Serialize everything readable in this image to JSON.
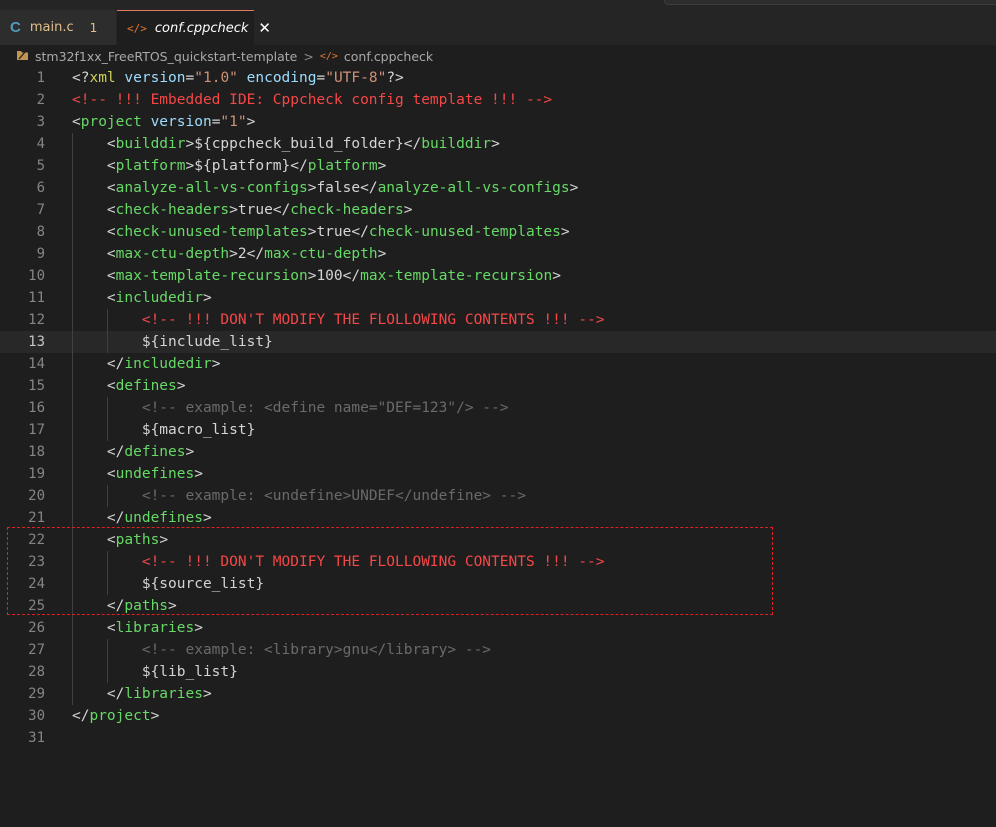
{
  "tabs": [
    {
      "icon": "c-file-icon",
      "icon_glyph": "C",
      "label": "main.c",
      "badge": "1",
      "active": false
    },
    {
      "icon": "xml-file-icon",
      "icon_glyph": "</>",
      "label": "conf.cppcheck",
      "active": true,
      "close_glyph": "✕"
    }
  ],
  "breadcrumb": {
    "folder": "stm32f1xx_FreeRTOS_quickstart-template",
    "separator": ">",
    "file": "conf.cppcheck",
    "file_icon_glyph": "</>"
  },
  "editor": {
    "current_line": 13,
    "lines": [
      {
        "n": "1",
        "html": "<span class='br'>&lt;?</span><span class='pi'>xml</span> <span class='attr'>version</span><span class='br'>=</span><span class='str'>\"1.0\"</span> <span class='attr'>encoding</span><span class='br'>=</span><span class='str'>\"UTF-8\"</span><span class='br'>?&gt;</span>"
      },
      {
        "n": "2",
        "html": "<span class='red'>&lt;!-- !!! Embedded IDE: Cppcheck config template !!! --&gt;</span>"
      },
      {
        "n": "3",
        "html": "<span class='br'>&lt;</span><span class='tag'>project</span> <span class='attr'>version</span><span class='br'>=</span><span class='str'>\"1\"</span><span class='br'>&gt;</span>"
      },
      {
        "n": "4",
        "indent": 1,
        "html": "    <span class='br'>&lt;</span><span class='tag'>builddir</span><span class='br'>&gt;</span><span class='txt'>${cppcheck_build_folder}</span><span class='br'>&lt;/</span><span class='tag'>builddir</span><span class='br'>&gt;</span>"
      },
      {
        "n": "5",
        "indent": 1,
        "html": "    <span class='br'>&lt;</span><span class='tag'>platform</span><span class='br'>&gt;</span><span class='txt'>${platform}</span><span class='br'>&lt;/</span><span class='tag'>platform</span><span class='br'>&gt;</span>"
      },
      {
        "n": "6",
        "indent": 1,
        "html": "    <span class='br'>&lt;</span><span class='tag'>analyze-all-vs-configs</span><span class='br'>&gt;</span><span class='txt'>false</span><span class='br'>&lt;/</span><span class='tag'>analyze-all-vs-configs</span><span class='br'>&gt;</span>"
      },
      {
        "n": "7",
        "indent": 1,
        "html": "    <span class='br'>&lt;</span><span class='tag'>check-headers</span><span class='br'>&gt;</span><span class='txt'>true</span><span class='br'>&lt;/</span><span class='tag'>check-headers</span><span class='br'>&gt;</span>"
      },
      {
        "n": "8",
        "indent": 1,
        "html": "    <span class='br'>&lt;</span><span class='tag'>check-unused-templates</span><span class='br'>&gt;</span><span class='txt'>true</span><span class='br'>&lt;/</span><span class='tag'>check-unused-templates</span><span class='br'>&gt;</span>"
      },
      {
        "n": "9",
        "indent": 1,
        "html": "    <span class='br'>&lt;</span><span class='tag'>max-ctu-depth</span><span class='br'>&gt;</span><span class='txt'>2</span><span class='br'>&lt;/</span><span class='tag'>max-ctu-depth</span><span class='br'>&gt;</span>"
      },
      {
        "n": "10",
        "indent": 1,
        "html": "    <span class='br'>&lt;</span><span class='tag'>max-template-recursion</span><span class='br'>&gt;</span><span class='txt'>100</span><span class='br'>&lt;/</span><span class='tag'>max-template-recursion</span><span class='br'>&gt;</span>"
      },
      {
        "n": "11",
        "indent": 1,
        "html": "    <span class='br'>&lt;</span><span class='tag'>includedir</span><span class='br'>&gt;</span>"
      },
      {
        "n": "12",
        "indent": 2,
        "html": "        <span class='red'>&lt;!-- !!! DON'T MODIFY THE FLOLLOWING CONTENTS !!! --&gt;</span>"
      },
      {
        "n": "13",
        "indent": 2,
        "html": "        <span class='txt'>${include_list}</span>"
      },
      {
        "n": "14",
        "indent": 1,
        "html": "    <span class='br'>&lt;/</span><span class='tag'>includedir</span><span class='br'>&gt;</span>"
      },
      {
        "n": "15",
        "indent": 1,
        "html": "    <span class='br'>&lt;</span><span class='tag'>defines</span><span class='br'>&gt;</span>"
      },
      {
        "n": "16",
        "indent": 2,
        "html": "        <span class='cmt'>&lt;!-- example: &lt;define name=\"DEF=123\"/&gt; --&gt;</span>"
      },
      {
        "n": "17",
        "indent": 2,
        "html": "        <span class='txt'>${macro_list}</span>"
      },
      {
        "n": "18",
        "indent": 1,
        "html": "    <span class='br'>&lt;/</span><span class='tag'>defines</span><span class='br'>&gt;</span>"
      },
      {
        "n": "19",
        "indent": 1,
        "html": "    <span class='br'>&lt;</span><span class='tag'>undefines</span><span class='br'>&gt;</span>"
      },
      {
        "n": "20",
        "indent": 2,
        "html": "        <span class='cmt'>&lt;!-- example: &lt;undefine&gt;UNDEF&lt;/undefine&gt; --&gt;</span>"
      },
      {
        "n": "21",
        "indent": 1,
        "html": "    <span class='br'>&lt;/</span><span class='tag'>undefines</span><span class='br'>&gt;</span>"
      },
      {
        "n": "22",
        "indent": 1,
        "html": "    <span class='br'>&lt;</span><span class='tag'>paths</span><span class='br'>&gt;</span>"
      },
      {
        "n": "23",
        "indent": 2,
        "html": "        <span class='red'>&lt;!-- !!! DON'T MODIFY THE FLOLLOWING CONTENTS !!! --&gt;</span>"
      },
      {
        "n": "24",
        "indent": 2,
        "html": "        <span class='txt'>${source_list}</span>"
      },
      {
        "n": "25",
        "indent": 1,
        "html": "    <span class='br'>&lt;/</span><span class='tag'>paths</span><span class='br'>&gt;</span>"
      },
      {
        "n": "26",
        "indent": 1,
        "html": "    <span class='br'>&lt;</span><span class='tag'>libraries</span><span class='br'>&gt;</span>"
      },
      {
        "n": "27",
        "indent": 2,
        "html": "        <span class='cmt'>&lt;!-- example: &lt;library&gt;gnu&lt;/library&gt; --&gt;</span>"
      },
      {
        "n": "28",
        "indent": 2,
        "html": "        <span class='txt'>${lib_list}</span>"
      },
      {
        "n": "29",
        "indent": 1,
        "html": "    <span class='br'>&lt;/</span><span class='tag'>libraries</span><span class='br'>&gt;</span>"
      },
      {
        "n": "30",
        "html": "<span class='br'>&lt;/</span><span class='tag'>project</span><span class='br'>&gt;</span>"
      },
      {
        "n": "31",
        "html": ""
      }
    ]
  },
  "colors": {
    "editor_bg": "#1e1e1e",
    "tag": "#66d966",
    "attribute": "#9cdcfe",
    "string": "#ce9178",
    "warning_comment": "#f44747",
    "comment": "#6a6a6a",
    "highlight_box": "#e02020"
  }
}
